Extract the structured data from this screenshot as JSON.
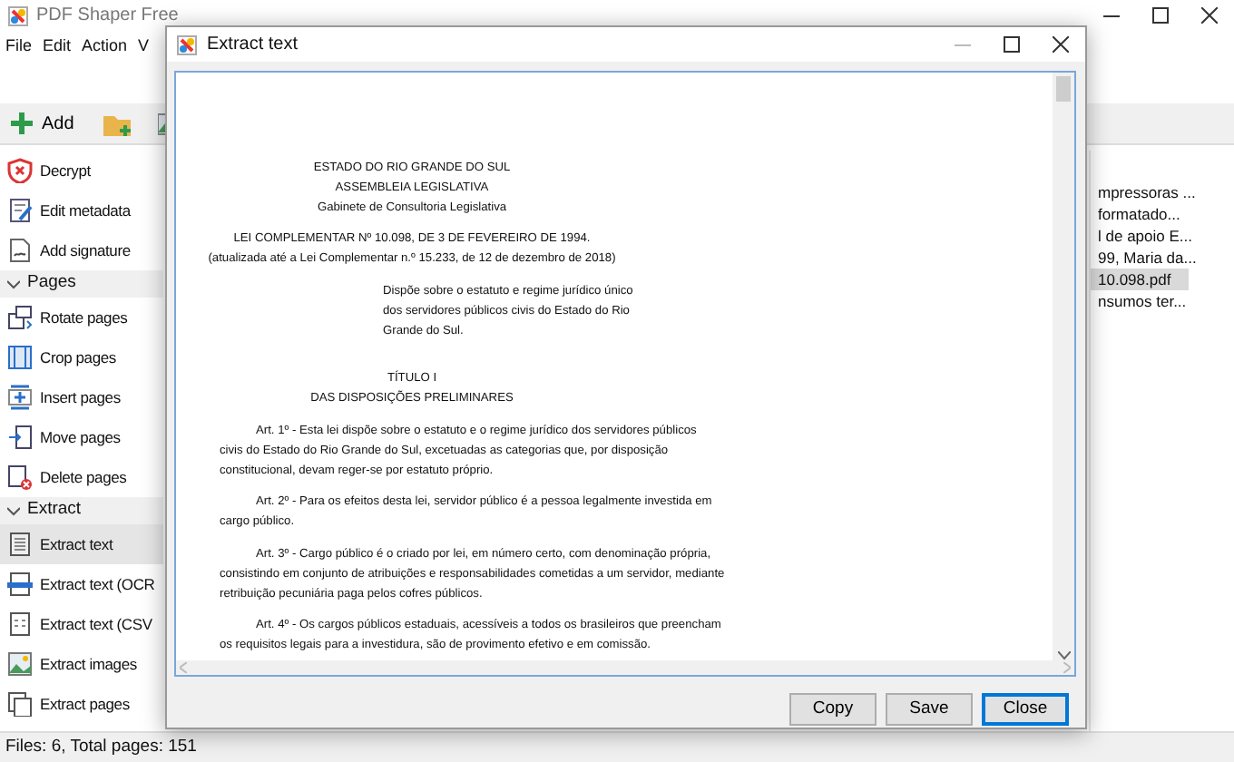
{
  "app": {
    "title": "PDF Shaper Free"
  },
  "menu": [
    "File",
    "Edit",
    "Action",
    "V"
  ],
  "toolbar": {
    "add_label": "Add"
  },
  "sidebar": {
    "items": [
      {
        "kind": "item",
        "label": "Decrypt",
        "selected": false
      },
      {
        "kind": "item",
        "label": "Edit metadata",
        "selected": false
      },
      {
        "kind": "item",
        "label": "Add signature",
        "selected": false
      },
      {
        "kind": "section",
        "label": "Pages",
        "expanded": true
      },
      {
        "kind": "item",
        "label": "Rotate pages",
        "selected": false
      },
      {
        "kind": "item",
        "label": "Crop pages",
        "selected": false
      },
      {
        "kind": "item",
        "label": "Insert pages",
        "selected": false
      },
      {
        "kind": "item",
        "label": "Move pages",
        "selected": false
      },
      {
        "kind": "item",
        "label": "Delete pages",
        "selected": false
      },
      {
        "kind": "section",
        "label": "Extract",
        "expanded": true
      },
      {
        "kind": "item",
        "label": "Extract text",
        "selected": true
      },
      {
        "kind": "item",
        "label": "Extract text (OCR",
        "selected": false
      },
      {
        "kind": "item",
        "label": "Extract text (CSV",
        "selected": false
      },
      {
        "kind": "item",
        "label": "Extract images",
        "selected": false
      },
      {
        "kind": "item",
        "label": "Extract pages",
        "selected": false
      }
    ]
  },
  "files": [
    {
      "name": "mpressoras ...",
      "selected": false
    },
    {
      "name": "formatado...",
      "selected": false
    },
    {
      "name": "l de apoio E...",
      "selected": false
    },
    {
      "name": "99, Maria da...",
      "selected": false
    },
    {
      "name": "10.098.pdf",
      "selected": true
    },
    {
      "name": "nsumos ter...",
      "selected": false
    }
  ],
  "status_bar": "Files: 6, Total pages: 151",
  "dialog": {
    "title": "Extract text",
    "blocks": [
      {
        "kind": "centered",
        "lines": [
          "ESTADO DO RIO GRANDE DO SUL",
          "ASSEMBLEIA LEGISLATIVA",
          "Gabinete de Consultoria Legislativa"
        ]
      },
      {
        "kind": "centered",
        "lines": [
          "LEI COMPLEMENTAR Nº 10.098, DE 3 DE FEVEREIRO DE 1994.",
          "(atualizada até a Lei Complementar n.º 15.233, de 12 de dezembro de 2018)"
        ]
      },
      {
        "kind": "summary",
        "lines": [
          "Dispõe sobre o estatuto e regime jurídico único",
          "dos servidores públicos civis do Estado do Rio",
          "Grande do Sul."
        ]
      },
      {
        "kind": "centered",
        "lines": [
          "TÍTULO I",
          "DAS DISPOSIÇÕES PRELIMINARES"
        ]
      },
      {
        "kind": "article",
        "lines": [
          "Art. 1º - Esta lei dispõe sobre o estatuto e o regime jurídico dos servidores públicos",
          "civis do Estado do Rio Grande do Sul, excetuadas as categorias que, por disposição",
          "constitucional, devam reger-se por estatuto próprio."
        ]
      },
      {
        "kind": "article",
        "lines": [
          "Art. 2º - Para os efeitos desta lei, servidor público é a pessoa legalmente investida em",
          "cargo público."
        ]
      },
      {
        "kind": "article",
        "lines": [
          "Art. 3º - Cargo público é o criado por lei, em número certo, com denominação própria,",
          "consistindo em conjunto de atribuições e responsabilidades cometidas a um servidor, mediante",
          "retribuição pecuniária paga pelos cofres públicos."
        ]
      },
      {
        "kind": "article",
        "lines": [
          "Art. 4º - Os cargos públicos estaduais, acessíveis a todos os brasileiros que preencham",
          "os requisitos legais para a investidura, são de provimento efetivo e em comissão."
        ]
      }
    ],
    "buttons": [
      {
        "label": "Copy",
        "default": false
      },
      {
        "label": "Save",
        "default": false
      },
      {
        "label": "Close",
        "default": true
      }
    ]
  }
}
